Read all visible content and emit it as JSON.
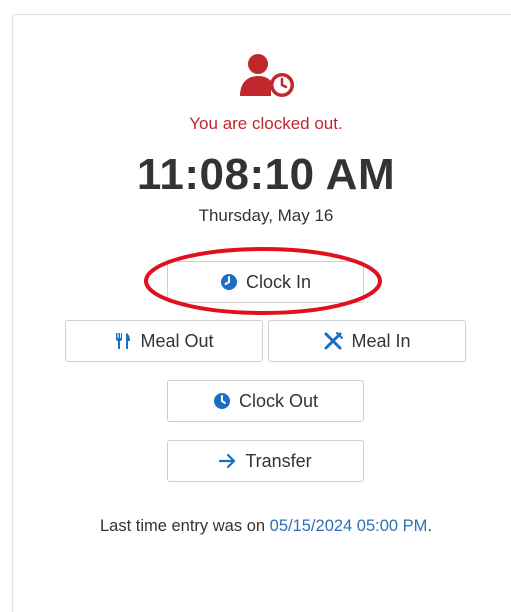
{
  "status": {
    "icon": "user-clock-icon",
    "message": "You are clocked out.",
    "color": "#c0282d"
  },
  "clock": {
    "time": "11:08:10 AM",
    "date": "Thursday, May 16"
  },
  "buttons": {
    "clock_in": {
      "label": "Clock In",
      "icon": "clock-icon"
    },
    "meal_out": {
      "label": "Meal Out",
      "icon": "fork-knife-icon"
    },
    "meal_in": {
      "label": "Meal In",
      "icon": "utensils-crossed-icon"
    },
    "clock_out": {
      "label": "Clock Out",
      "icon": "clock-icon"
    },
    "transfer": {
      "label": "Transfer",
      "icon": "arrow-right-icon"
    }
  },
  "footer": {
    "prefix": "Last time entry was on",
    "timestamp": "05/15/2024 05:00 PM",
    "suffix": "."
  },
  "colors": {
    "accent": "#1a6fc4",
    "link": "#2f6fb4",
    "alert": "#c0282d",
    "highlight": "#e0101e"
  }
}
